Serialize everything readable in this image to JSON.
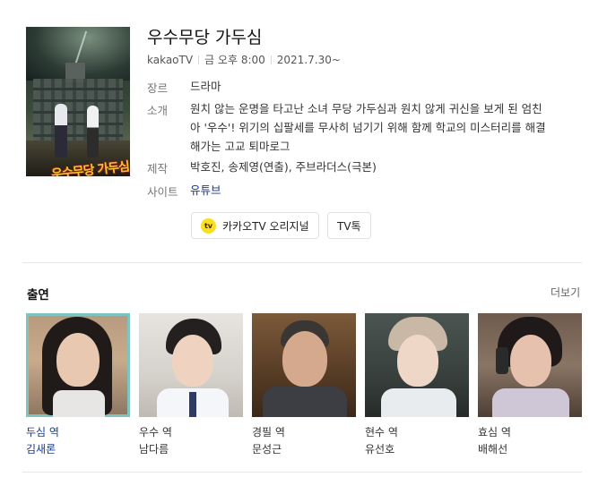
{
  "show": {
    "title": "우수무당 가두심",
    "meta": [
      "kakaoTV",
      "금 오후 8:00",
      "2021.7.30~"
    ],
    "poster_logo": "우수무당 가두심"
  },
  "info": {
    "genre_label": "장르",
    "genre_value": "드라마",
    "synopsis_label": "소개",
    "synopsis_lines": [
      "원치 않는 운명을 타고난 소녀 무당 가두심과 원치 않게 귀신을 보게 된 엄친",
      "아 '우수'! 위기의 십팔세를 무사히 넘기기 위해 함께 학교의 미스터리를 해결",
      "해가는 고교 퇴마로그"
    ],
    "production_label": "제작",
    "production_value": "박호진, 송제영(연출), 주브라더스(극본)",
    "site_label": "사이트",
    "site_value": "유튜브"
  },
  "chips": {
    "kakao_icon_text": "tv",
    "kakao_label": "카카오TV 오리지널",
    "tvtalk_label": "TV톡"
  },
  "cast_section": {
    "title": "출연",
    "more": "더보기",
    "members": [
      {
        "role": "두심 역",
        "name": "김새론"
      },
      {
        "role": "우수 역",
        "name": "남다름"
      },
      {
        "role": "경필 역",
        "name": "문성근"
      },
      {
        "role": "현수 역",
        "name": "유선호"
      },
      {
        "role": "효심 역",
        "name": "배해선"
      }
    ]
  },
  "colors": {
    "accent_link": "#1a3a8a",
    "selected_outline": "#7fc4c0",
    "kakao_yellow": "#f9df1c"
  }
}
